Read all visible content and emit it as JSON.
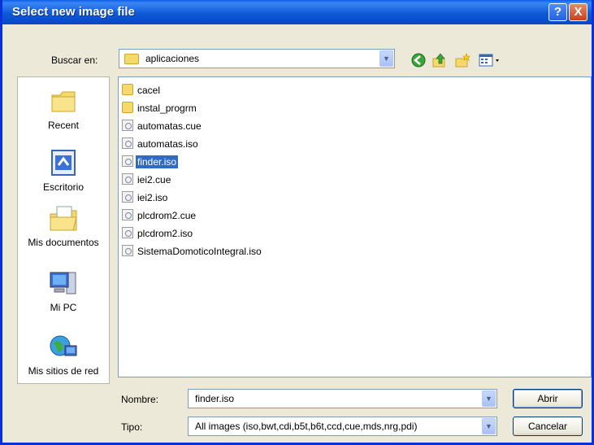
{
  "window": {
    "title": "Select new image file",
    "help_label": "?",
    "close_label": "X"
  },
  "lookin": {
    "label": "Buscar en:",
    "value": "aplicaciones"
  },
  "places": [
    {
      "label": "Recent",
      "icon": "recent-folder-icon"
    },
    {
      "label": "Escritorio",
      "icon": "desktop-icon"
    },
    {
      "label": "Mis documentos",
      "icon": "my-documents-icon"
    },
    {
      "label": "Mi PC",
      "icon": "my-computer-icon"
    },
    {
      "label": "Mis sitios de red",
      "icon": "network-places-icon"
    }
  ],
  "files": [
    {
      "name": "cacel",
      "type": "folder"
    },
    {
      "name": "instal_progrm",
      "type": "folder"
    },
    {
      "name": "automatas.cue",
      "type": "file"
    },
    {
      "name": "automatas.iso",
      "type": "file"
    },
    {
      "name": "finder.iso",
      "type": "file",
      "selected": true
    },
    {
      "name": "iei2.cue",
      "type": "file"
    },
    {
      "name": "iei2.iso",
      "type": "file"
    },
    {
      "name": "plcdrom2.cue",
      "type": "file"
    },
    {
      "name": "plcdrom2.iso",
      "type": "file"
    },
    {
      "name": "SistemaDomoticoIntegral.iso",
      "type": "file"
    }
  ],
  "filename": {
    "label": "Nombre:",
    "value": "finder.iso"
  },
  "filetype": {
    "label": "Tipo:",
    "value": "All images (iso,bwt,cdi,b5t,b6t,ccd,cue,mds,nrg,pdi)"
  },
  "buttons": {
    "open": "Abrir",
    "cancel": "Cancelar"
  },
  "colors": {
    "titlebar": "#0a5fe8",
    "selection": "#316ac5",
    "dialog_bg": "#ece9d8"
  }
}
